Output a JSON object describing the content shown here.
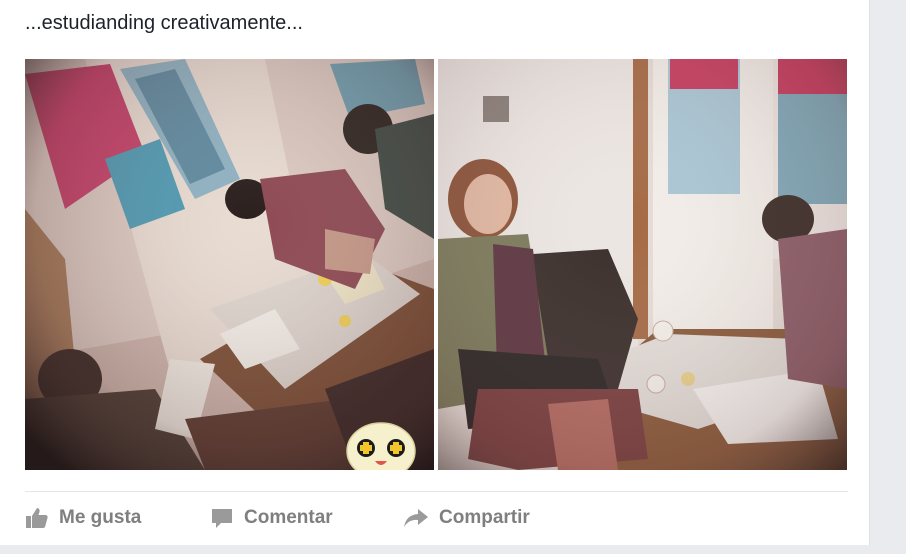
{
  "post": {
    "caption": "...estudianding creativamente...",
    "photos": [
      {
        "description_icon": "photo-icon"
      },
      {
        "description_icon": "photo-icon"
      }
    ],
    "sticker_icon": "emoji-sticker-icon"
  },
  "actions": {
    "like_label": "Me gusta",
    "comment_label": "Comentar",
    "share_label": "Compartir"
  },
  "colors": {
    "action_text": "#7f7f7f",
    "caption_text": "#1d2129",
    "page_bg": "#e9ebee",
    "card_bg": "#ffffff"
  }
}
